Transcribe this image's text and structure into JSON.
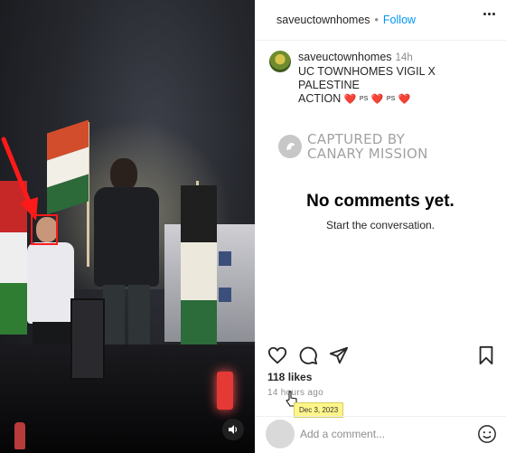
{
  "header": {
    "username": "saveuctownhomes",
    "separator": "•",
    "follow_label": "Follow"
  },
  "caption": {
    "username": "saveuctownhomes",
    "time": "14h",
    "text_line1": "UC TOWNHOMES VIGIL X PALESTINE",
    "text_line2": "ACTION",
    "tokens": [
      "❤️",
      "PS",
      "❤️",
      "PS",
      "❤️"
    ]
  },
  "watermark": {
    "line1": "CAPTURED BY",
    "line2": "CANARY MISSION"
  },
  "comments": {
    "empty_title": "No comments yet.",
    "empty_subtitle": "Start the conversation."
  },
  "actions": {
    "icons": [
      "heart-icon",
      "comment-icon",
      "share-icon",
      "bookmark-icon"
    ]
  },
  "likes": "118 likes",
  "time_ago": "14 hours ago",
  "tooltip": "Dec 3, 2023",
  "add_comment": {
    "placeholder": "Add a comment..."
  },
  "colors": {
    "follow": "#0095f6",
    "highlight": "#ff1a1a",
    "tooltip_bg": "#fff68a"
  }
}
